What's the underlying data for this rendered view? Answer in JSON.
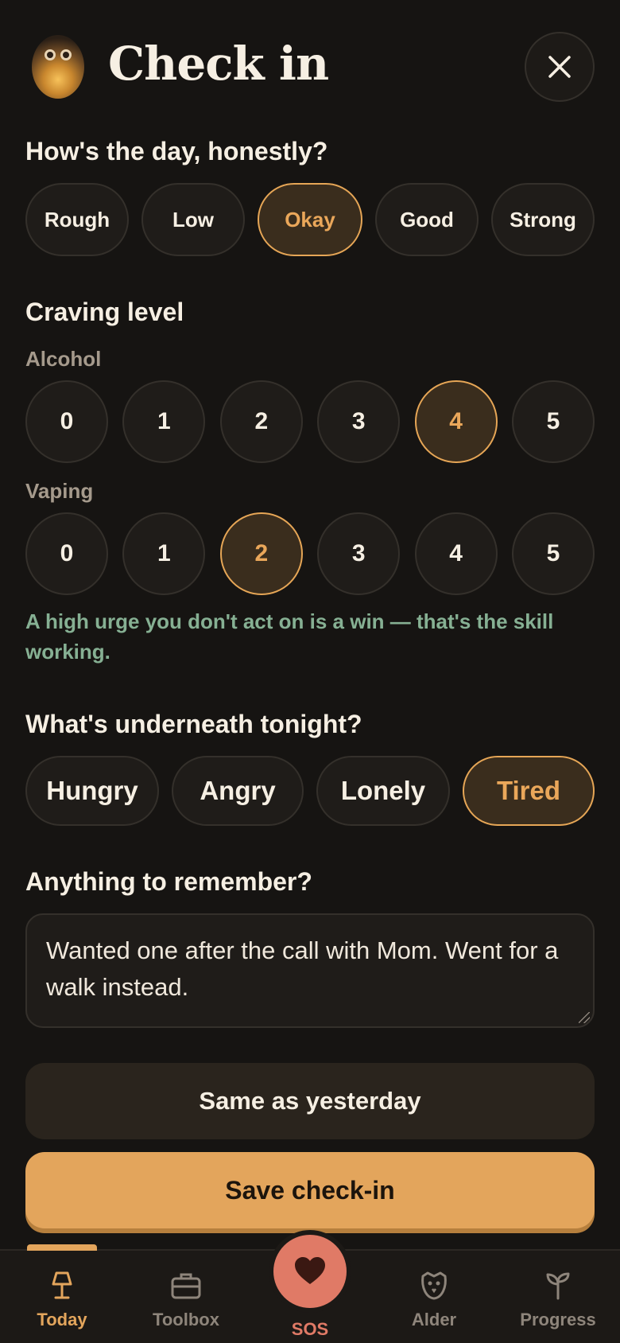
{
  "header": {
    "title": "Check in"
  },
  "mood": {
    "label": "How's the day, honestly?",
    "options": [
      "Rough",
      "Low",
      "Okay",
      "Good",
      "Strong"
    ],
    "selected": "Okay"
  },
  "craving": {
    "label": "Craving level",
    "alcohol": {
      "label": "Alcohol",
      "levels": [
        "0",
        "1",
        "2",
        "3",
        "4",
        "5"
      ],
      "selected": "4"
    },
    "vaping": {
      "label": "Vaping",
      "levels": [
        "0",
        "1",
        "2",
        "3",
        "4",
        "5"
      ],
      "selected": "2"
    },
    "hint": "A high urge you don't act on is a win — that's the skill working."
  },
  "underneath": {
    "label": "What's underneath tonight?",
    "options": [
      "Hungry",
      "Angry",
      "Lonely",
      "Tired"
    ],
    "selected": "Tired"
  },
  "notes": {
    "label": "Anything to remember?",
    "value": "Wanted one after the call with Mom. Went for a walk instead."
  },
  "actions": {
    "same_label": "Same as yesterday",
    "save_label": "Save check-in"
  },
  "tabs": {
    "today": "Today",
    "toolbox": "Toolbox",
    "sos": "SOS",
    "alder": "Alder",
    "progress": "Progress"
  },
  "colors": {
    "accent": "#e3a55c",
    "hint": "#86b093",
    "sos": "#e07a66",
    "background": "#161412"
  }
}
